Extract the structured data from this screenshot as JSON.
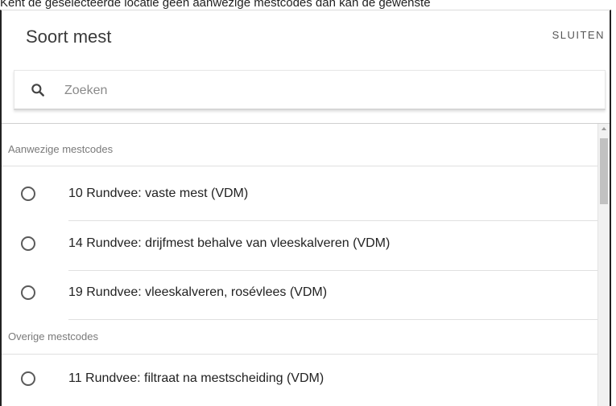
{
  "top_text": "Kent de geselecteerde locatie geen aanwezige mestcodes dan kan de gewenste",
  "dialog": {
    "title": "Soort mest",
    "close_label": "SLUITEN"
  },
  "search": {
    "placeholder": "Zoeken",
    "value": ""
  },
  "sections": [
    {
      "header": "Aanwezige mestcodes",
      "items": [
        "10 Rundvee: vaste mest (VDM)",
        "14 Rundvee: drijfmest behalve van vleeskalveren (VDM)",
        "19 Rundvee: vleeskalveren, rosévlees (VDM)"
      ]
    },
    {
      "header": "Overige mestcodes",
      "items": [
        "11 Rundvee: filtraat na mestscheiding (VDM)"
      ]
    }
  ],
  "icons": {
    "search": "search-icon",
    "radio": "radio-unchecked-icon"
  },
  "colors": {
    "border": "#222222",
    "section_text": "#7a7a7a",
    "radio": "#5a5a5a"
  }
}
